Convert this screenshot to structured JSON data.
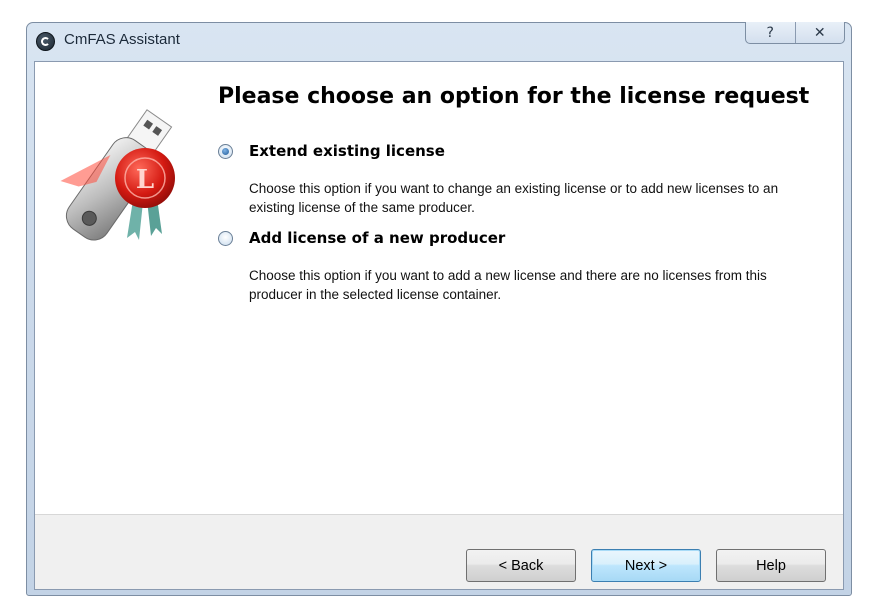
{
  "window": {
    "title": "CmFAS Assistant",
    "help_glyph": "?",
    "close_glyph": "✕"
  },
  "wizard": {
    "heading": "Please choose an option for the license request",
    "options": [
      {
        "label": "Extend existing license",
        "description": "Choose this option if you want to change an existing license or to add new licenses to an existing license of the same producer.",
        "selected": true
      },
      {
        "label": "Add license of a new producer",
        "description": "Choose this option if you want to add a new license and there are no licenses from this producer in the selected license container.",
        "selected": false
      }
    ]
  },
  "buttons": {
    "back": "< Back",
    "next": "Next >",
    "help": "Help"
  },
  "icons": {
    "app": "cmfas-app-icon",
    "header_graphic": "usb-license-key-icon"
  }
}
